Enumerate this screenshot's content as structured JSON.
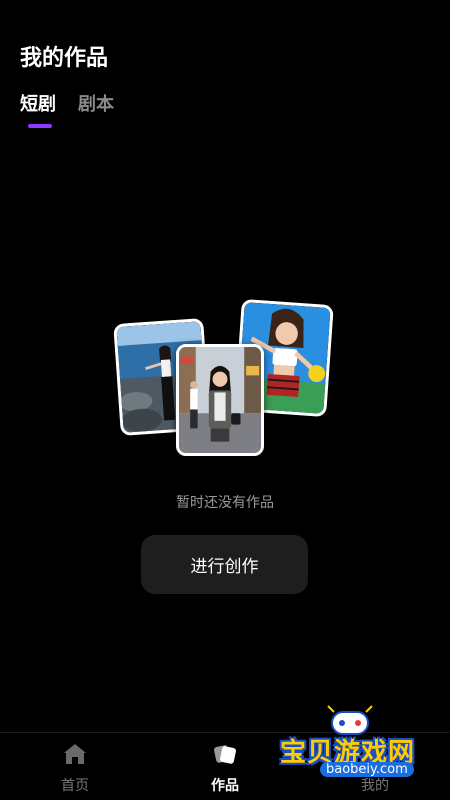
{
  "header": {
    "title": "我的作品"
  },
  "tabs": [
    {
      "label": "短剧",
      "active": true
    },
    {
      "label": "剧本",
      "active": false
    }
  ],
  "accent_color": "#8b3bff",
  "empty_state": {
    "message": "暂时还没有作品",
    "button_label": "进行创作",
    "images": [
      "seaside-photo",
      "street-photo",
      "cheerleader-photo"
    ]
  },
  "bottom_nav": [
    {
      "label": "首页",
      "icon": "home-icon",
      "active": false
    },
    {
      "label": "作品",
      "icon": "works-icon",
      "active": true
    },
    {
      "label": "我的",
      "icon": "profile-icon",
      "active": false
    }
  ],
  "watermark": {
    "text": "宝贝游戏网",
    "url": "baobeiy.com"
  }
}
